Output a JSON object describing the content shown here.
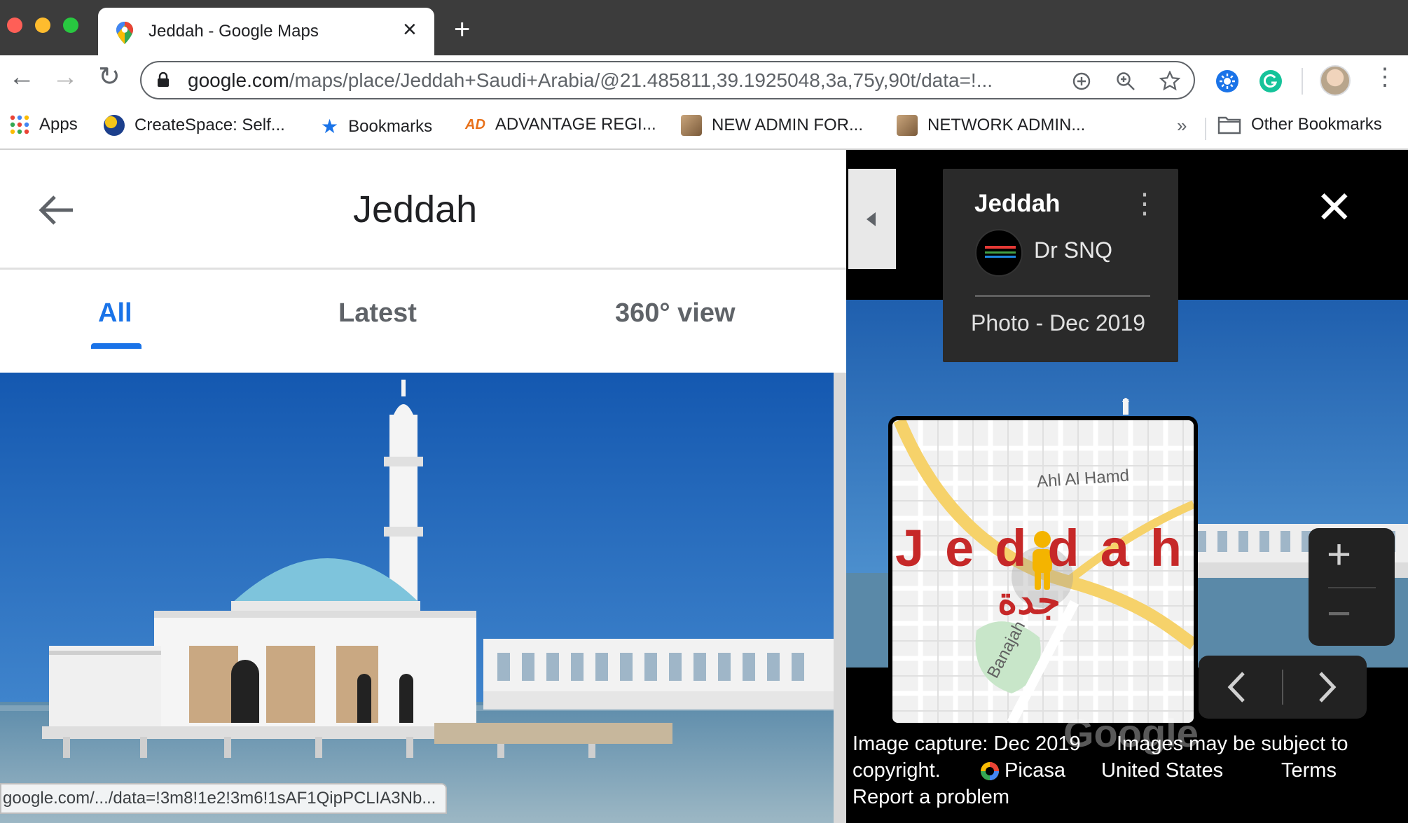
{
  "browser": {
    "tab_title": "Jeddah - Google Maps",
    "url_host": "google.com",
    "url_path": "/maps/place/Jeddah+Saudi+Arabia/@21.485811,39.1925048,3a,75y,90t/data=!...",
    "bookmarks": [
      "Apps",
      "CreateSpace: Self...",
      "Bookmarks",
      "ADVANTAGE REGI...",
      "NEW ADMIN FOR...",
      "NETWORK ADMIN..."
    ],
    "overflow_label": "»",
    "other_bookmarks": "Other Bookmarks"
  },
  "place": {
    "title": "Jeddah",
    "tabs": [
      "All",
      "Latest",
      "360° view"
    ],
    "active_tab": "All",
    "status_url": "google.com/.../data=!3m8!1e2!3m6!1sAF1QipPCLIA3Nb..."
  },
  "viewer": {
    "card_title": "Jeddah",
    "author": "Dr SNQ",
    "photo_date": "Photo - Dec 2019",
    "map_labels": {
      "district": "Ahl Al Hamd",
      "city_latin": "Jeddah",
      "city_arabic": "جدة",
      "street": "Banajah"
    },
    "zoom_in": "+",
    "zoom_out": "−",
    "footer": {
      "capture": "Image capture: Dec 2019",
      "rights": "Images may be subject to",
      "copyright": "copyright.",
      "picasa": "Picasa",
      "country": "United States",
      "terms": "Terms",
      "report": "Report a problem",
      "watermark": "Google"
    }
  },
  "colors": {
    "accent": "#1a73e8",
    "tab_strip": "#3c3c3c",
    "map_road": "#f6d26a",
    "map_label_red": "#c62828"
  }
}
